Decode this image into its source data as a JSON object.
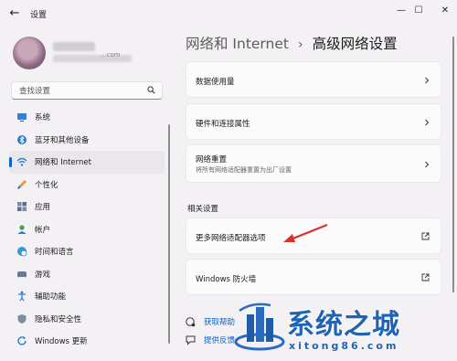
{
  "window": {
    "title": "设置",
    "back_glyph": "←",
    "minimize_glyph": "—",
    "maximize_glyph": "☐",
    "close_glyph": "✕"
  },
  "profile": {
    "email_tail": "...com"
  },
  "search": {
    "placeholder": "查找设置"
  },
  "sidebar": {
    "items": [
      {
        "label": "系统",
        "icon": "monitor-icon",
        "active": false
      },
      {
        "label": "蓝牙和其他设备",
        "icon": "bluetooth-icon",
        "active": false
      },
      {
        "label": "网络和 Internet",
        "icon": "wifi-icon",
        "active": true
      },
      {
        "label": "个性化",
        "icon": "brush-icon",
        "active": false
      },
      {
        "label": "应用",
        "icon": "apps-icon",
        "active": false
      },
      {
        "label": "帐户",
        "icon": "person-icon",
        "active": false
      },
      {
        "label": "时间和语言",
        "icon": "globe-clock-icon",
        "active": false
      },
      {
        "label": "游戏",
        "icon": "gamepad-icon",
        "active": false
      },
      {
        "label": "辅助功能",
        "icon": "accessibility-icon",
        "active": false
      },
      {
        "label": "隐私和安全性",
        "icon": "shield-icon",
        "active": false
      },
      {
        "label": "Windows 更新",
        "icon": "update-icon",
        "active": false
      }
    ]
  },
  "breadcrumb": {
    "parent": "网络和 Internet",
    "separator": "›",
    "current": "高级网络设置"
  },
  "cards": [
    {
      "title": "数据使用量",
      "subtitle": "",
      "action": "chevron-right-icon"
    },
    {
      "title": "硬件和连接属性",
      "subtitle": "",
      "action": "chevron-right-icon"
    },
    {
      "title": "网络重置",
      "subtitle": "将所有网络适配器重置为出厂设置",
      "action": "chevron-right-icon"
    }
  ],
  "related": {
    "label": "相关设置",
    "items": [
      {
        "title": "更多网络适配器选项",
        "action": "external-link-icon"
      },
      {
        "title": "Windows 防火墙",
        "action": "external-link-icon"
      }
    ]
  },
  "bottom_links": [
    {
      "label": "获取帮助",
      "icon": "help-icon"
    },
    {
      "label": "提供反馈",
      "icon": "feedback-icon"
    }
  ],
  "watermark": {
    "title": "系统之城",
    "url": "xitong86.com"
  },
  "colors": {
    "accent": "#0a63c9",
    "background": "#f4f1f5",
    "card": "#fbfbfb",
    "annotation_arrow": "#d9312b"
  }
}
